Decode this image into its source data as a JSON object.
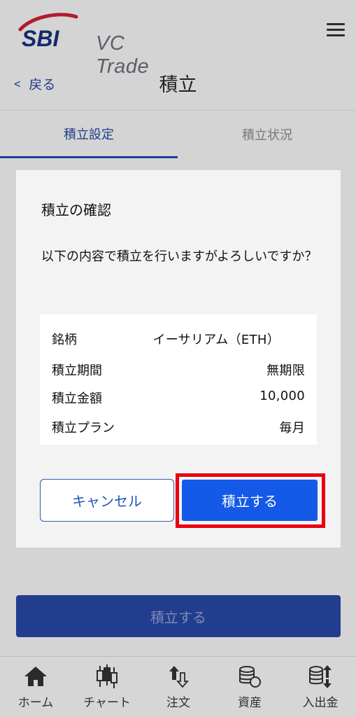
{
  "header": {
    "brand": "SBI",
    "product": "VC Trade",
    "back_label": "戻る",
    "title": "積立"
  },
  "tabs": [
    {
      "label": "積立設定",
      "active": true
    },
    {
      "label": "積立状況",
      "active": false
    }
  ],
  "modal": {
    "title": "積立の確認",
    "message": "以下の内容で積立を行いますがよろしいですか？",
    "details": [
      {
        "key": "銘柄",
        "value": "イーサリアム（ETH）"
      },
      {
        "key": "積立期間",
        "value": "無期限"
      },
      {
        "key": "積立金額",
        "value": "10,000"
      },
      {
        "key": "積立プラン",
        "value": "毎月"
      }
    ],
    "cancel_label": "キャンセル",
    "confirm_label": "積立する"
  },
  "page_submit_label": "積立する",
  "bottom_nav": [
    {
      "label": "ホーム",
      "icon": "home-icon"
    },
    {
      "label": "チャート",
      "icon": "candlestick-chart-icon"
    },
    {
      "label": "注文",
      "icon": "order-arrows-icon"
    },
    {
      "label": "資産",
      "icon": "coins-icon"
    },
    {
      "label": "入出金",
      "icon": "deposit-withdraw-icon"
    }
  ],
  "colors": {
    "brand_blue": "#1f3d9a",
    "confirm_blue": "#1559e8",
    "highlight_red": "#e8000f",
    "overlay_gray": "#d4d4d4"
  }
}
